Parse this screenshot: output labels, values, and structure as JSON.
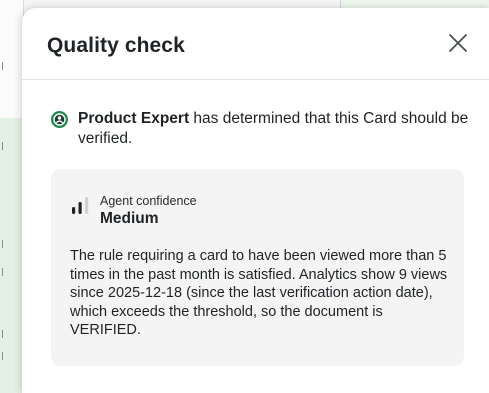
{
  "panel": {
    "title": "Quality check",
    "close_label": "×"
  },
  "determination": {
    "actor": "Product Expert",
    "message": " has determined that this Card should be verified."
  },
  "confidence": {
    "label": "Agent confidence",
    "level": "Medium",
    "explanation": "The rule requiring a card to have been viewed more than 5 times in the past month is satisfied. Analytics show 9 views since 2025-12-18 (since the last verification action date), which exceeds the threshold, so the document is VERIFIED."
  },
  "colors": {
    "accent_green": "#1f8a4c",
    "card_bg": "#f4f4f4",
    "text": "#1f2326"
  },
  "icons": {
    "close": "close-icon",
    "avatar": "product-expert-avatar-icon",
    "confidence": "signal-bars-icon"
  }
}
